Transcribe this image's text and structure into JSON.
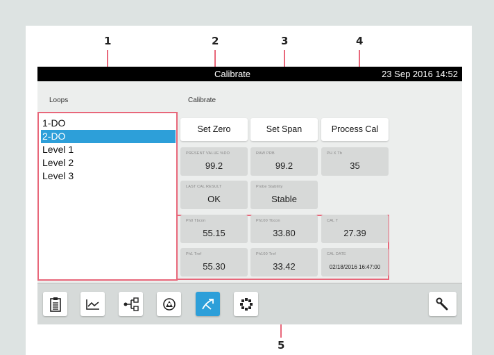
{
  "callouts": {
    "c1": "1",
    "c2": "2",
    "c3": "3",
    "c4": "4",
    "c5": "5"
  },
  "topbar": {
    "title": "Calibrate",
    "datetime": "23 Sep 2016  14:52"
  },
  "labels": {
    "loops": "Loops",
    "calibrate": "Calibrate"
  },
  "loops": [
    "1-DO",
    "2-DO",
    "Level 1",
    "Level 2",
    "Level 3"
  ],
  "selected_loop": "2-DO",
  "buttons": {
    "set_zero": "Set Zero",
    "set_span": "Set Span",
    "process_cal": "Process Cal"
  },
  "readings": {
    "present_value": {
      "label": "PRESENT VALUE %DO",
      "value": "99.2"
    },
    "raw_prb": {
      "label": "RAW PRB",
      "value": "99.2"
    },
    "ph_x_tb": {
      "label": "PH X Tb",
      "value": "35"
    },
    "last_cal": {
      "label": "LAST CAL RESULT",
      "value": "OK"
    },
    "probe_stability": {
      "label": "Probe Stability",
      "value": "Stable"
    }
  },
  "cal_data": {
    "ph0_tbcon": {
      "label": "Ph0 Tbcon",
      "value": "55.15"
    },
    "ph100_tbcon": {
      "label": "Ph100 Tbcon",
      "value": "33.80"
    },
    "cal_t": {
      "label": "CAL T",
      "value": "27.39"
    },
    "ph1_tref": {
      "label": "Ph1 Tref",
      "value": "55.30"
    },
    "ph100_tref": {
      "label": "Ph100 Tref",
      "value": "33.42"
    },
    "cal_date": {
      "label": "CAL DATE",
      "value": "02/18/2016 16:47:00"
    }
  },
  "toolbar": [
    "clipboard-icon",
    "trend-chart-icon",
    "network-icon",
    "loops-overview-icon",
    "calibrate-icon",
    "settings-grid-icon"
  ],
  "colors": {
    "accent": "#2d9fd9",
    "callout": "#e8677a",
    "topbar": "#000000"
  }
}
